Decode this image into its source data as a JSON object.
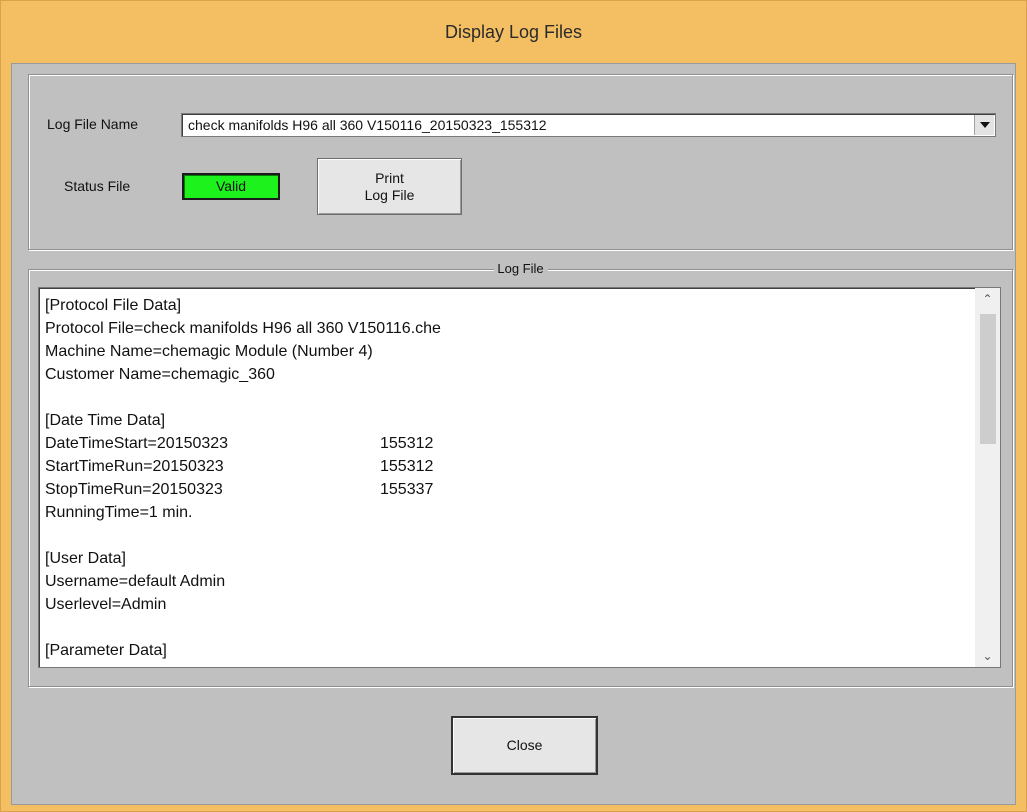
{
  "window": {
    "title": "Display Log Files"
  },
  "top_group": {
    "log_file_name_label": "Log File Name",
    "log_file_name_value": "check manifolds H96 all 360 V150116_20150323_155312",
    "status_file_label": "Status File",
    "status_value": "Valid",
    "print_button": {
      "line1": "Print",
      "line2": "Log File"
    }
  },
  "log_group": {
    "legend": "Log File",
    "lines": [
      [
        "[Protocol File Data]",
        ""
      ],
      [
        "Protocol File=check manifolds H96 all 360 V150116.che",
        ""
      ],
      [
        "Machine Name=chemagic Module (Number 4)",
        ""
      ],
      [
        "Customer Name=chemagic_360",
        ""
      ],
      [
        "",
        ""
      ],
      [
        "[Date Time Data]",
        ""
      ],
      [
        "DateTimeStart=20150323",
        "155312"
      ],
      [
        "StartTimeRun=20150323",
        "155312"
      ],
      [
        "StopTimeRun=20150323",
        "155337"
      ],
      [
        "RunningTime=1 min.",
        ""
      ],
      [
        "",
        ""
      ],
      [
        "[User Data]",
        ""
      ],
      [
        "Username=default Admin",
        ""
      ],
      [
        "Userlevel=Admin",
        ""
      ],
      [
        "",
        ""
      ],
      [
        "[Parameter Data]",
        ""
      ]
    ]
  },
  "close_button": "Close",
  "colors": {
    "status_valid": "#1df21d",
    "title_bar": "#f4bf63",
    "client_bg": "#c0c0c0"
  }
}
